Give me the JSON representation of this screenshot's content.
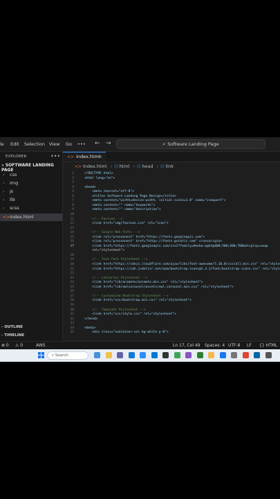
{
  "title_bar": {
    "menus": [
      "le",
      "Edit",
      "Selection",
      "View",
      "Go",
      "•••"
    ],
    "back_arrow": "←",
    "forward_arrow": "→",
    "search_text": "Software Landing Page",
    "search_icon": "search-icon"
  },
  "sidebar": {
    "header": "EXPLORER",
    "more": "•••",
    "project": "SOFTWARE LANDING PAGE",
    "items": [
      {
        "label": "css",
        "type": "folder"
      },
      {
        "label": "img",
        "type": "folder"
      },
      {
        "label": "js",
        "type": "folder"
      },
      {
        "label": "lib",
        "type": "folder"
      },
      {
        "label": "scss",
        "type": "folder"
      },
      {
        "label": "index.html",
        "type": "file",
        "active": true
      }
    ],
    "outline": "OUTLINE",
    "timeline": "TIMELINE"
  },
  "editor": {
    "tab_label": "index.html",
    "tab_close": "×",
    "breadcrumbs": [
      "index.html",
      "html",
      "head",
      "link"
    ],
    "lines": [
      {
        "n": "1",
        "t": "<!DOCTYPE html>"
      },
      {
        "n": "2",
        "t": "<html lang=\"en\">"
      },
      {
        "n": "3",
        "t": ""
      },
      {
        "n": "4",
        "t": "<head>"
      },
      {
        "n": "5",
        "t": "    <meta charset=\"utf-8\">"
      },
      {
        "n": "6",
        "t": "    <title> Software Landing Page Design</title>"
      },
      {
        "n": "7",
        "t": "    <meta content=\"width=device-width, initial-scale=1.0\" name=\"viewport\">"
      },
      {
        "n": "8",
        "t": "    <meta content=\"\" name=\"keywords\">"
      },
      {
        "n": "9",
        "t": "    <meta content=\"\" name=\"description\">"
      },
      {
        "n": "10",
        "t": ""
      },
      {
        "n": "11",
        "t": "    <!-- Favicon -->"
      },
      {
        "n": "12",
        "t": "    <link href=\"img/favicon.ico\" rel=\"icon\">"
      },
      {
        "n": "13",
        "t": ""
      },
      {
        "n": "14",
        "t": "    <!-- Google Web Fonts -->"
      },
      {
        "n": "15",
        "t": "    <link rel=\"preconnect\" href=\"https://fonts.googleapis.com\">"
      },
      {
        "n": "16",
        "t": "    <link rel=\"preconnect\" href=\"https://fonts.gstatic.com\" crossorigin>"
      },
      {
        "n": "17",
        "t": "    <link href=\"https://fonts.googleapis.com/css2?family=Heebo:wght@400;500;600;700&display=swap"
      },
      {
        "n": "",
        "t": "    rel=\"stylesheet\">"
      },
      {
        "n": "18",
        "t": ""
      },
      {
        "n": "19",
        "t": "    <!-- Icon Font Stylesheet -->"
      },
      {
        "n": "20",
        "t": "    <link href=\"https://cdnjs.cloudflare.com/ajax/libs/font-awesome/5.10.0/css/all.min.css\" rel=\"stylesh"
      },
      {
        "n": "21",
        "t": "    <link href=\"https://cdn.jsdelivr.net/npm/bootstrap-icons@1.4.1/font/bootstrap-icons.css\" rel=\"stylesh"
      },
      {
        "n": "22",
        "t": ""
      },
      {
        "n": "23",
        "t": "    <!-- Libraries Stylesheet -->"
      },
      {
        "n": "24",
        "t": "    <link href=\"lib/animate/animate.min.css\" rel=\"stylesheet\">"
      },
      {
        "n": "25",
        "t": "    <link href=\"lib/owlcarousel/assets/owl.carousel.min.css\" rel=\"stylesheet\">"
      },
      {
        "n": "26",
        "t": ""
      },
      {
        "n": "27",
        "t": "    <!-- Customized Bootstrap Stylesheet -->"
      },
      {
        "n": "28",
        "t": "    <link href=\"css/bootstrap.min.css\" rel=\"stylesheet\">"
      },
      {
        "n": "29",
        "t": ""
      },
      {
        "n": "30",
        "t": "    <!-- Template Stylesheet -->"
      },
      {
        "n": "31",
        "t": "    <link href=\"css/style.css\" rel=\"stylesheet\">"
      },
      {
        "n": "32",
        "t": "</head>"
      },
      {
        "n": "33",
        "t": ""
      },
      {
        "n": "34",
        "t": "<body>"
      },
      {
        "n": "35",
        "t": "    <div class=\"container-xxl bg-white p-0\">"
      }
    ],
    "current_line": "17"
  },
  "status_bar": {
    "errors": "⊗ 0",
    "warnings": "⚠ 0",
    "aws": "AWS",
    "position": "Ln 17, Col 49",
    "spaces": "Spaces: 4",
    "encoding": "UTF-8",
    "eol": "LF",
    "language": "{} HTML"
  },
  "taskbar": {
    "search": "Search",
    "icons": [
      "widgets-icon",
      "files-icon",
      "chat-icon",
      "edge-icon",
      "store-icon",
      "mail-icon",
      "terminal-icon",
      "app-icon",
      "app-icon",
      "app-icon",
      "folder-icon",
      "facebook-icon",
      "settings-icon",
      "chrome-icon",
      "vscode-icon",
      "app-icon"
    ],
    "colors": [
      "#4a90d9",
      "#f0c14b",
      "#6264a7",
      "#0f7bd8",
      "#2d8cff",
      "#0078d4",
      "#333333",
      "#3aa657",
      "#8a56c2",
      "#2e7d32",
      "#f2b84b",
      "#1877f2",
      "#777777",
      "#db4437",
      "#0065a9",
      "#555555"
    ]
  }
}
